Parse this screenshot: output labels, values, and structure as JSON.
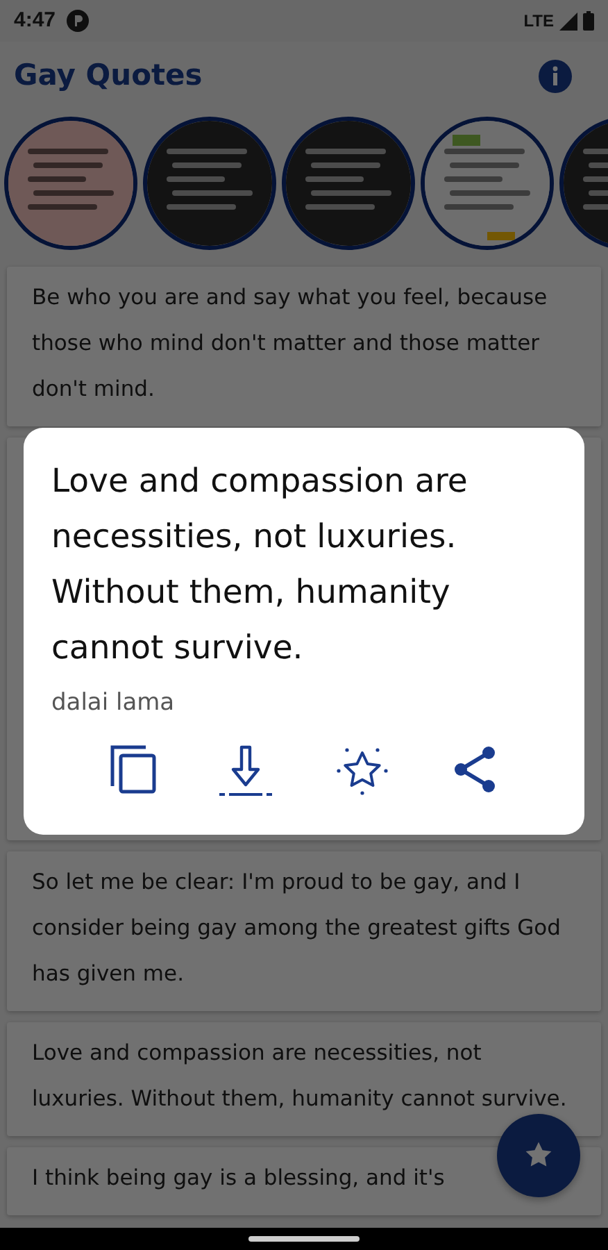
{
  "status_bar": {
    "time": "4:47",
    "network": "LTE"
  },
  "app_bar": {
    "title": "Gay Quotes"
  },
  "quotes": [
    {
      "text": "Be who you are and say what you feel, because those who mind don't matter and those matter don't mind."
    },
    {
      "text": "So let me be clear: I'm proud to be gay, and I consider being gay among the greatest gifts God has given me."
    },
    {
      "text": "Love and compassion are necessities, not luxuries. Without them, humanity cannot survive."
    },
    {
      "text": "I think being gay is a blessing, and it's"
    }
  ],
  "dialog": {
    "quote": "Love and compassion are necessities, not luxuries. Without them, humanity cannot survive.",
    "author": "dalai lama",
    "actions": [
      {
        "kind": "copy"
      },
      {
        "kind": "download"
      },
      {
        "kind": "favorite"
      },
      {
        "kind": "share"
      }
    ]
  }
}
